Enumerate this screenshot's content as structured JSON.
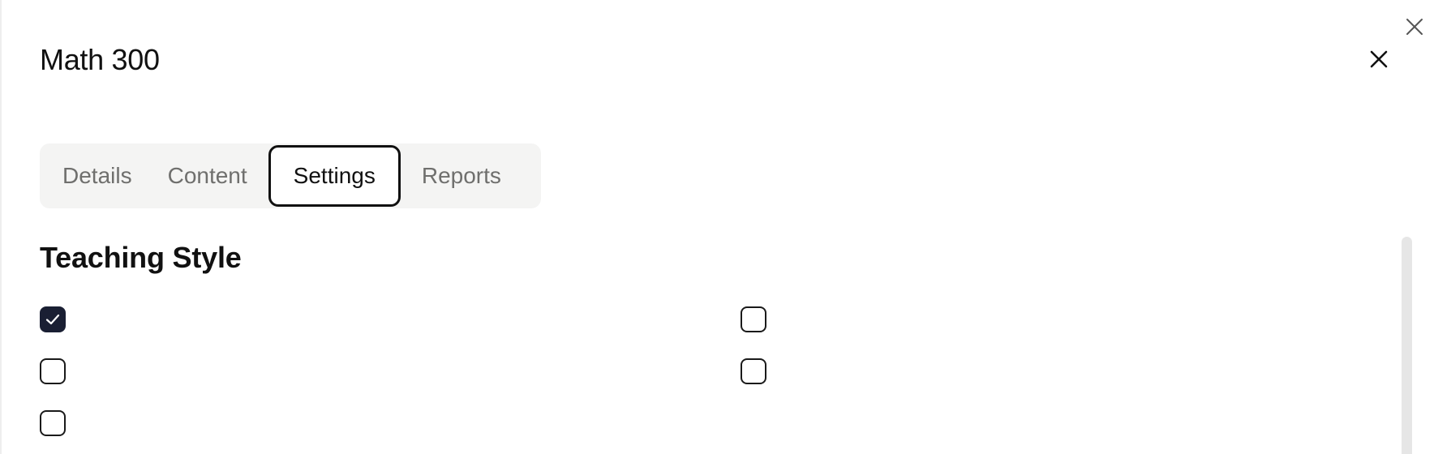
{
  "panel": {
    "title": "Math 300"
  },
  "tabs": [
    {
      "label": "Details",
      "active": false
    },
    {
      "label": "Content",
      "active": false
    },
    {
      "label": "Settings",
      "active": true
    },
    {
      "label": "Reports",
      "active": false
    }
  ],
  "section": {
    "title": "Teaching Style"
  },
  "checkboxes": [
    {
      "checked": true
    },
    {
      "checked": false
    },
    {
      "checked": false
    },
    {
      "checked": false
    },
    {
      "checked": false
    }
  ],
  "icons": {
    "outer_close": "close-icon",
    "panel_close": "close-icon",
    "check": "checkmark-icon"
  },
  "colors": {
    "checkbox_checked": "#1a1f33",
    "tab_bar_bg": "#f4f4f3",
    "inactive_tab_text": "#6f6f6d"
  }
}
